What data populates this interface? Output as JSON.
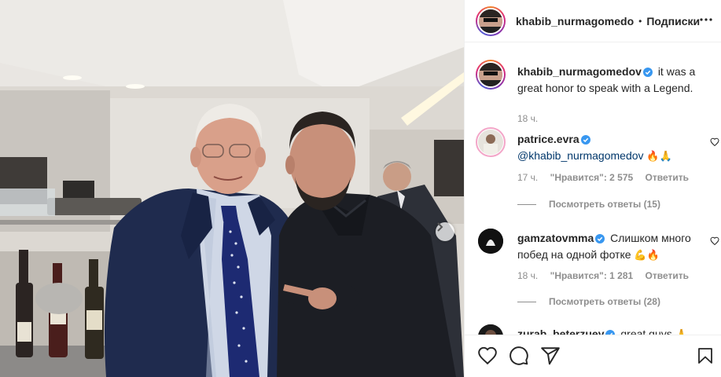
{
  "colors": {
    "link": "#00376b",
    "muted": "#8e8e8e",
    "verified": "#3897f0",
    "text": "#262626"
  },
  "photo": {
    "icon": "chevron-right-icon"
  },
  "header": {
    "username": "khabib_nurmagomedo",
    "dot": "•",
    "follow": "Подписки",
    "more_icon": "more-options-icon"
  },
  "caption": {
    "username": "khabib_nurmagomedov",
    "text": "it was a great honor to speak with a Legend.",
    "time": "18 ч."
  },
  "comments": [
    {
      "username": "patrice.evra",
      "mention": "@khabib_nurmagomedov",
      "emoji": "🔥🙏",
      "time": "17 ч.",
      "likes": "\"Нравится\": 2 575",
      "reply": "Ответить",
      "replies": "Посмотреть ответы (15)"
    },
    {
      "username": "gamzatovmma",
      "text": "Слишком много побед на одной фотке",
      "emoji": "💪🔥",
      "time": "18 ч.",
      "likes": "\"Нравится\": 1 281",
      "reply": "Ответить",
      "replies": "Посмотреть ответы (28)"
    },
    {
      "username": "zurab_beterzuev",
      "text": "great guys",
      "emoji": "🙏"
    }
  ],
  "actions": {
    "like_icon": "heart-icon",
    "comment_icon": "comment-icon",
    "share_icon": "share-icon",
    "save_icon": "bookmark-icon"
  }
}
